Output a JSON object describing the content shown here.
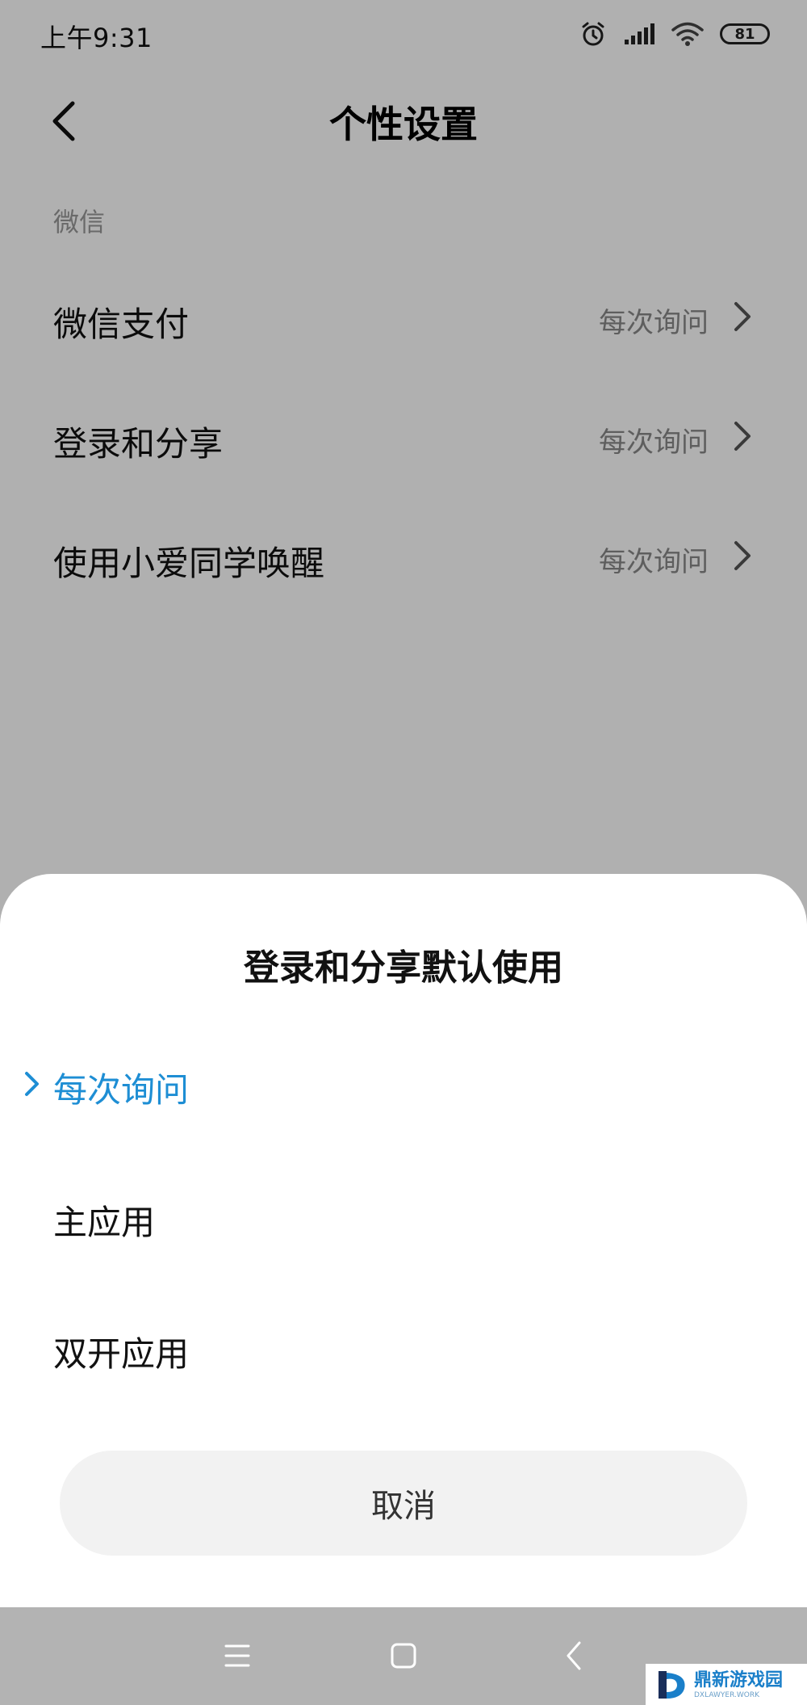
{
  "status_bar": {
    "time": "上午9:31",
    "battery": "81",
    "icons": [
      "alarm-icon",
      "signal-icon",
      "wifi-icon",
      "battery-icon"
    ]
  },
  "header": {
    "title": "个性设置",
    "back_icon": "chevron-left-icon"
  },
  "section": {
    "label": "微信"
  },
  "settings": [
    {
      "label": "微信支付",
      "value": "每次询问"
    },
    {
      "label": "登录和分享",
      "value": "每次询问"
    },
    {
      "label": "使用小爱同学唤醒",
      "value": "每次询问"
    }
  ],
  "sheet": {
    "title": "登录和分享默认使用",
    "options": [
      {
        "label": "每次询问",
        "selected": true
      },
      {
        "label": "主应用",
        "selected": false
      },
      {
        "label": "双开应用",
        "selected": false
      }
    ],
    "cancel_label": "取消"
  },
  "nav": {
    "icons": [
      "menu-icon",
      "home-icon",
      "back-icon"
    ]
  },
  "watermark": {
    "main": "鼎新游戏园",
    "sub": "DXLAWYER.WORK"
  },
  "colors": {
    "accent": "#1e8ed4",
    "overlay": "rgba(0,0,0,0.31)",
    "nav_bar": "#b3b3b3",
    "cancel_bg": "#f2f2f2"
  }
}
